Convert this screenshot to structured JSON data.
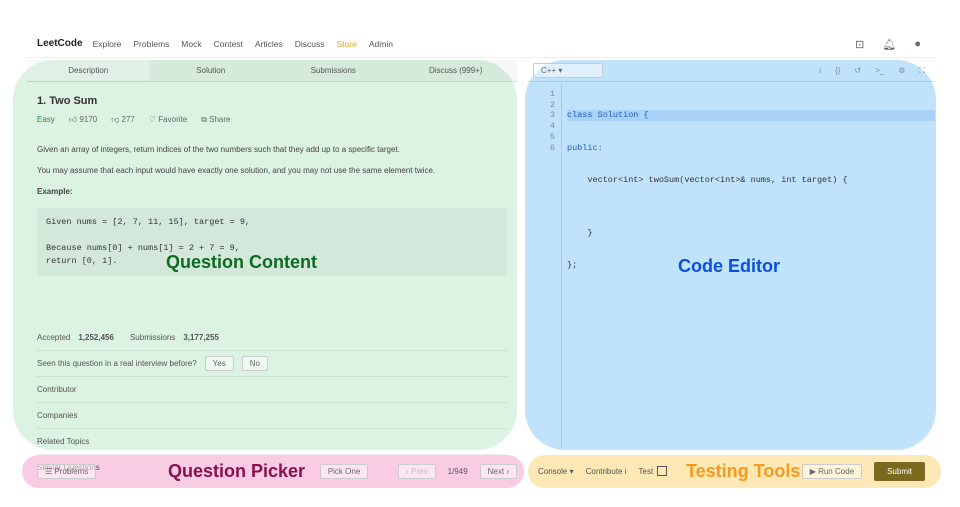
{
  "nav": {
    "logo": "LeetCode",
    "items": [
      "Explore",
      "Problems",
      "Mock",
      "Contest",
      "Articles",
      "Discuss",
      "Store",
      "Admin"
    ]
  },
  "tabs": [
    "Description",
    "Solution",
    "Submissions",
    "Discuss (999+)"
  ],
  "question": {
    "title": "1. Two Sum",
    "difficulty": "Easy",
    "likes": "9170",
    "dislikes": "277",
    "favorite": "Favorite",
    "share": "Share",
    "p1": "Given an array of integers, return indices of the two numbers such that they add up to a specific target.",
    "p2": "You may assume that each input would have exactly one solution, and you may not use the same element twice.",
    "example_label": "Example:",
    "example": "Given nums = [2, 7, 11, 15], target = 9,\n\nBecause nums[0] + nums[1] = 2 + 7 = 9,\nreturn [0, 1].",
    "accepted_label": "Accepted",
    "accepted": "1,252,456",
    "submissions_label": "Submissions",
    "submissions": "3,177,255",
    "interview": "Seen this question in a real interview before?",
    "yes": "Yes",
    "no": "No",
    "sections": [
      "Contributor",
      "Companies",
      "Related Topics",
      "Similar Questions"
    ]
  },
  "editor": {
    "language": "C++",
    "line_numbers": "1\n2\n3\n4\n5\n6",
    "code": [
      "class Solution {",
      "public:",
      "    vector<int> twoSum(vector<int>& nums, int target) {",
      "",
      "    }",
      "};"
    ]
  },
  "bottom": {
    "problems": "Problems",
    "pick_one": "Pick One",
    "prev": "‹ Prev",
    "page": "1/949",
    "next": "Next ›",
    "console": "Console ▾",
    "contribute": "Contribute i",
    "test": "Test",
    "run": "▶ Run Code",
    "submit": "Submit"
  },
  "overlays": {
    "question_content": "Question Content",
    "code_editor": "Code Editor",
    "question_picker": "Question Picker",
    "testing_tools": "Testing Tools"
  },
  "colors": {
    "green": "#bfe8cc",
    "blue": "#8ccbf5",
    "pink": "#f5a3cc",
    "yellow": "#fbd67a"
  }
}
